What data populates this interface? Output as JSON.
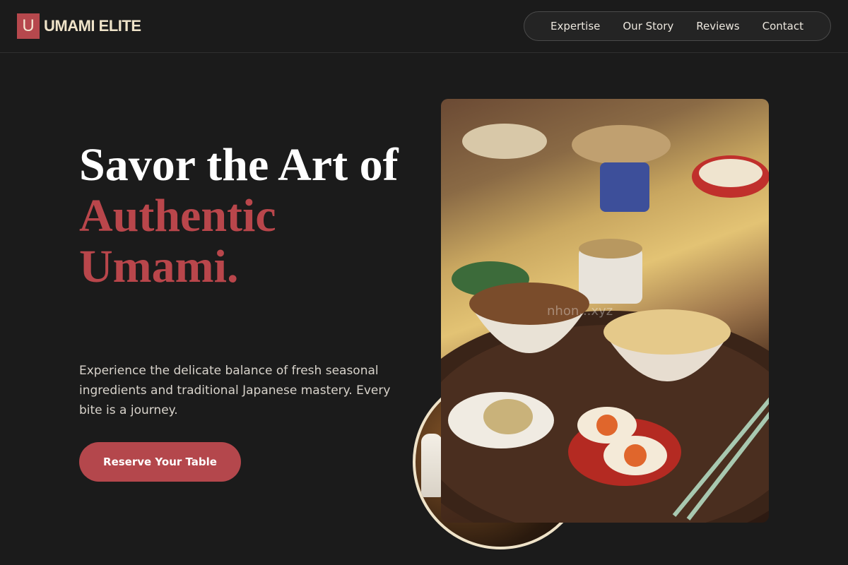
{
  "brand": {
    "mark": "U",
    "name": "UMAMI ELITE"
  },
  "nav": [
    {
      "label": "Expertise"
    },
    {
      "label": "Our Story"
    },
    {
      "label": "Reviews"
    },
    {
      "label": "Contact"
    }
  ],
  "hero": {
    "title_line1": "Savor the Art of",
    "title_accent": "Authentic Umami.",
    "description": "Experience the delicate balance of fresh seasonal ingredients and traditional Japanese mastery. Every bite is a journey.",
    "cta_label": "Reserve Your Table"
  },
  "images": {
    "main": "japanese-meal-photo",
    "secondary": "restaurant-kitchen-photo",
    "watermark": "nhon...xyz"
  },
  "colors": {
    "background": "#1b1b1b",
    "accent": "#b6484d",
    "cream": "#efe3c9"
  }
}
